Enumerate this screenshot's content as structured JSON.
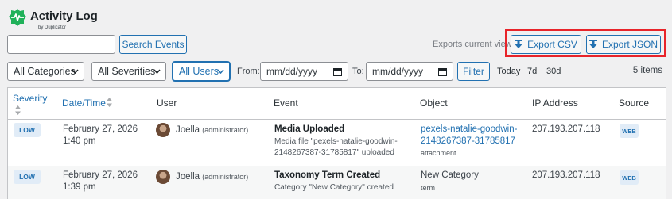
{
  "brand": {
    "title": "Activity Log",
    "subtitle": "by Duplicator",
    "accent": "#20b15a"
  },
  "search": {
    "placeholder": "",
    "value": "",
    "button_label": "Search Events"
  },
  "exports": {
    "label": "Exports current view",
    "csv_label": "Export CSV",
    "json_label": "Export JSON"
  },
  "filters": {
    "category": "All Categories",
    "severity": "All Severities",
    "users": "All Users",
    "from_label": "From:",
    "from_value": "mm/dd/yyyy",
    "to_label": "To:",
    "to_value": "mm/dd/yyyy",
    "filter_label": "Filter",
    "quick": [
      "Today",
      "7d",
      "30d"
    ],
    "items_count": "5 items"
  },
  "table": {
    "columns": [
      "Severity",
      "Date/Time",
      "User",
      "Event",
      "Object",
      "IP Address",
      "Source"
    ],
    "rows": [
      {
        "severity": "LOW",
        "date": "February 27, 2026",
        "time": "1:40 pm",
        "user": "Joella",
        "role": "(administrator)",
        "event": "Media Uploaded",
        "detail_1": "Media file \"pexels-natalie-goodwin-",
        "detail_2": "2148267387-31785817\" uploaded",
        "object_1": "pexels-natalie-goodwin-",
        "object_2": "2148267387-31785817",
        "object_type": "attachment",
        "ip": "207.193.207.118",
        "source": "WEB"
      },
      {
        "severity": "LOW",
        "date": "February 27, 2026",
        "time": "1:39 pm",
        "user": "Joella",
        "role": "(administrator)",
        "event": "Taxonomy Term Created",
        "detail_1": "Category \"New Category\" created",
        "object_1": "New Category",
        "object_type": "term",
        "ip": "207.193.207.118",
        "source": "WEB"
      }
    ]
  },
  "colors": {
    "link": "#2271b1",
    "highlight": "#e8242a",
    "badge_bg": "#e1ecf7"
  },
  "icons": [
    "activity-logo-icon",
    "download-icon",
    "chevron-down-icon",
    "calendar-icon",
    "sort-icon"
  ]
}
